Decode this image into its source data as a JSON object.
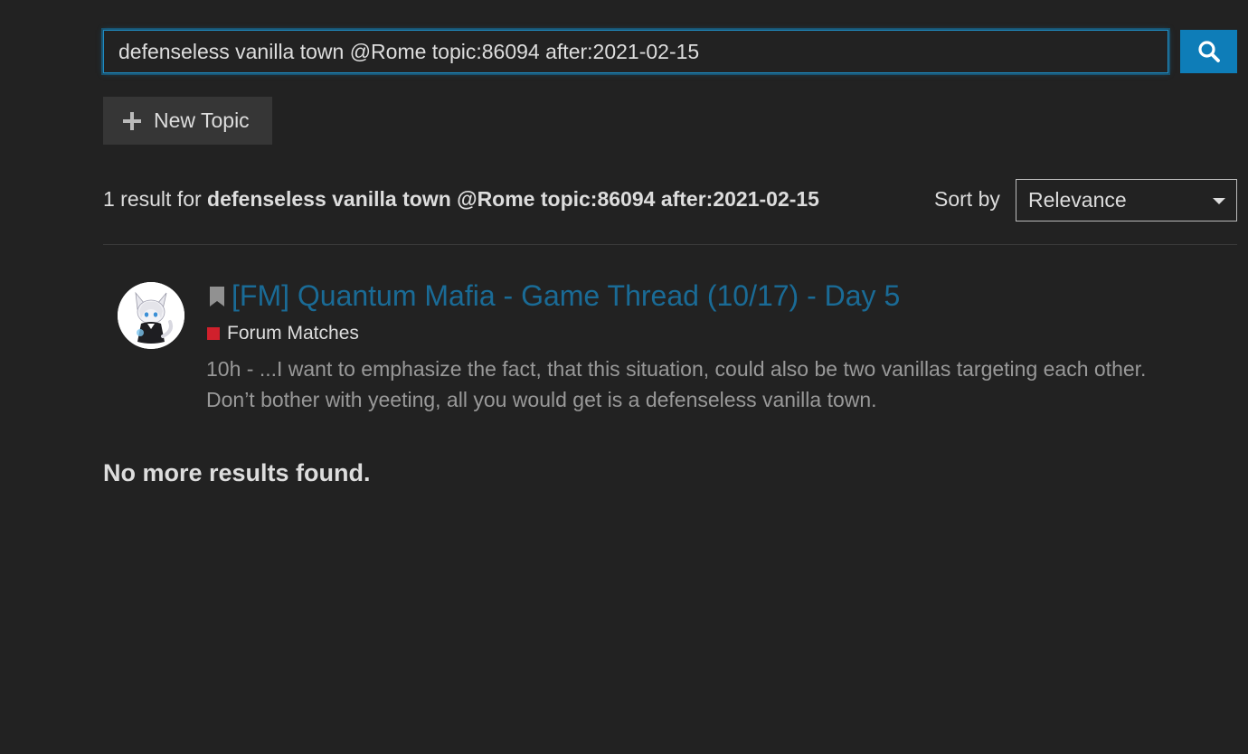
{
  "search": {
    "query": "defenseless vanilla town @Rome topic:86094 after:2021-02-15",
    "button_icon": "search-icon",
    "accent_color": "#0e7db8"
  },
  "toolbar": {
    "new_topic_label": "New Topic",
    "new_topic_icon": "plus-icon"
  },
  "results_header": {
    "count_prefix": "1 result for",
    "query_bold": "defenseless vanilla town @Rome topic:86094 after:2021-02-15",
    "sort_label": "Sort by",
    "sort_value": "Relevance"
  },
  "results": [
    {
      "title": "[FM] Quantum Mafia - Game Thread (10/17) - Day 5",
      "title_color": "#1a6b96",
      "category": "Forum Matches",
      "category_color": "#d0202c",
      "blurb": "10h - ...I want to emphasize the fact, that this situation, could also be two vanillas targeting each other. Don’t bother with yeeting, all you would get is a defenseless vanilla town.",
      "bookmark_icon": "bookmark-icon"
    }
  ],
  "footer": {
    "no_more": "No more results found."
  }
}
